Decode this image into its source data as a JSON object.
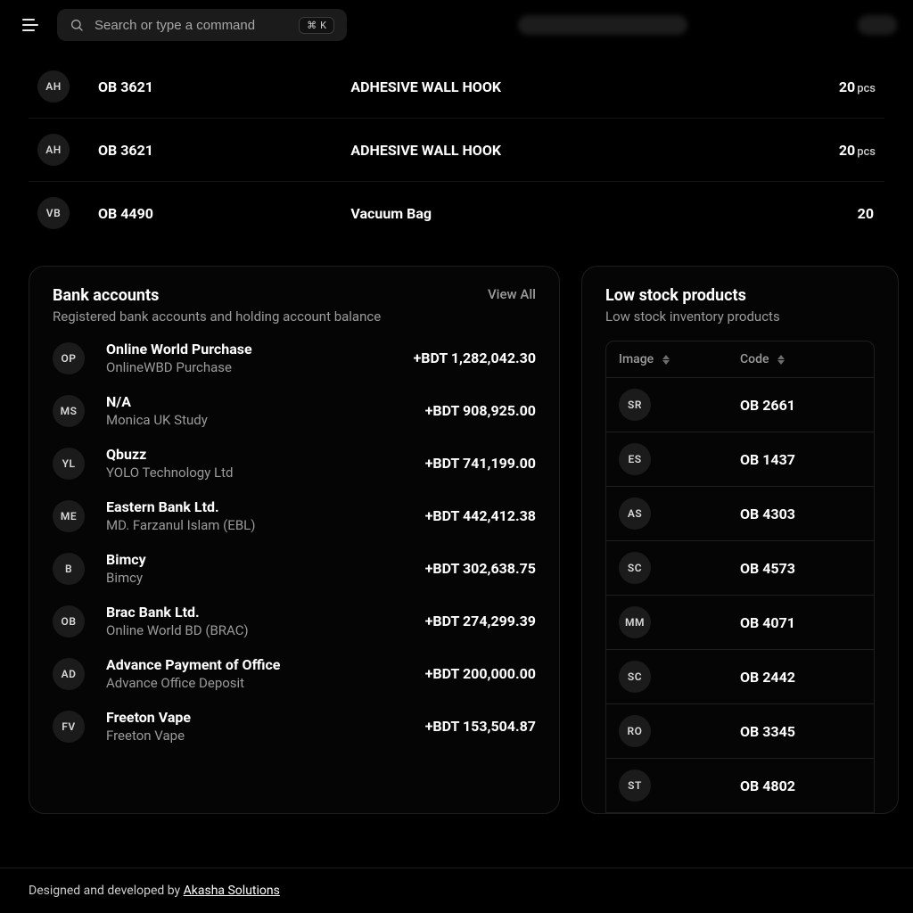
{
  "topbar": {
    "search_placeholder": "Search or type a command",
    "shortcut_cmd": "⌘",
    "shortcut_key": "K"
  },
  "products": {
    "rows": [
      {
        "avatar": "AH",
        "code": "OB 3621",
        "name": "ADHESIVE WALL HOOK",
        "qty": "20",
        "unit": "pcs"
      },
      {
        "avatar": "AH",
        "code": "OB 3621",
        "name": "ADHESIVE WALL HOOK",
        "qty": "20",
        "unit": "pcs"
      },
      {
        "avatar": "VB",
        "code": "OB 4490",
        "name": "Vacuum Bag",
        "qty": "20",
        "unit": ""
      }
    ]
  },
  "bank": {
    "title": "Bank accounts",
    "subtitle": "Registered bank accounts and holding account balance",
    "view_all": "View All",
    "rows": [
      {
        "avatar": "OP",
        "name": "Online World Purchase",
        "sub": "OnlineWBD Purchase",
        "balance": "+BDT 1,282,042.30"
      },
      {
        "avatar": "MS",
        "name": "N/A",
        "sub": "Monica UK Study",
        "balance": "+BDT 908,925.00"
      },
      {
        "avatar": "YL",
        "name": "Qbuzz",
        "sub": "YOLO Technology Ltd",
        "balance": "+BDT 741,199.00"
      },
      {
        "avatar": "ME",
        "name": "Eastern Bank Ltd.",
        "sub": "MD. Farzanul Islam (EBL)",
        "balance": "+BDT 442,412.38"
      },
      {
        "avatar": "B",
        "name": "Bimcy",
        "sub": "Bimcy",
        "balance": "+BDT 302,638.75"
      },
      {
        "avatar": "OB",
        "name": "Brac Bank Ltd.",
        "sub": "Online World BD (BRAC)",
        "balance": "+BDT 274,299.39"
      },
      {
        "avatar": "AD",
        "name": "Advance Payment of Office",
        "sub": "Advance Office Deposit",
        "balance": "+BDT 200,000.00"
      },
      {
        "avatar": "FV",
        "name": "Freeton Vape",
        "sub": "Freeton Vape",
        "balance": "+BDT 153,504.87"
      }
    ]
  },
  "low_stock": {
    "title": "Low stock products",
    "subtitle": "Low stock inventory products",
    "col_image": "Image",
    "col_code": "Code",
    "rows": [
      {
        "avatar": "SR",
        "code": "OB 2661"
      },
      {
        "avatar": "ES",
        "code": "OB 1437"
      },
      {
        "avatar": "AS",
        "code": "OB 4303"
      },
      {
        "avatar": "SC",
        "code": "OB 4573"
      },
      {
        "avatar": "MM",
        "code": "OB 4071"
      },
      {
        "avatar": "SC",
        "code": "OB 2442"
      },
      {
        "avatar": "RO",
        "code": "OB 3345"
      },
      {
        "avatar": "ST",
        "code": "OB 4802"
      }
    ]
  },
  "footer": {
    "prefix": "Designed and developed by ",
    "link": "Akasha Solutions"
  }
}
